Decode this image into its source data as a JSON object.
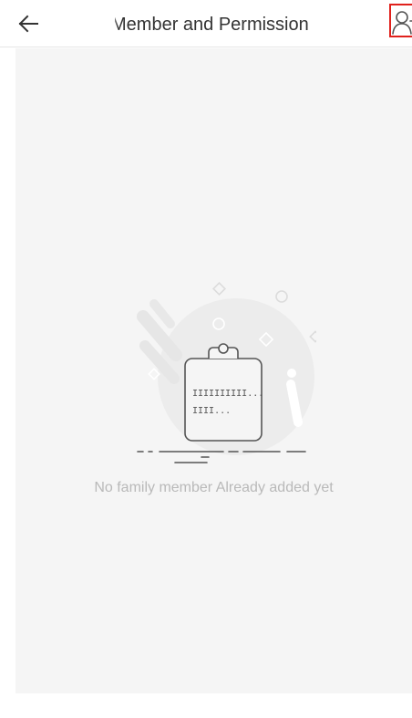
{
  "header": {
    "title": "Member and Permission",
    "back_icon": "arrow-left-icon",
    "add_member_icon": "person-add-icon",
    "highlight_color": "#e0211c"
  },
  "empty_state": {
    "illustration": "clipboard-empty-icon",
    "message": "No family member Already added yet"
  },
  "colors": {
    "background": "#f5f5f5",
    "text_primary": "#333333",
    "text_muted": "#b9b9b9"
  }
}
